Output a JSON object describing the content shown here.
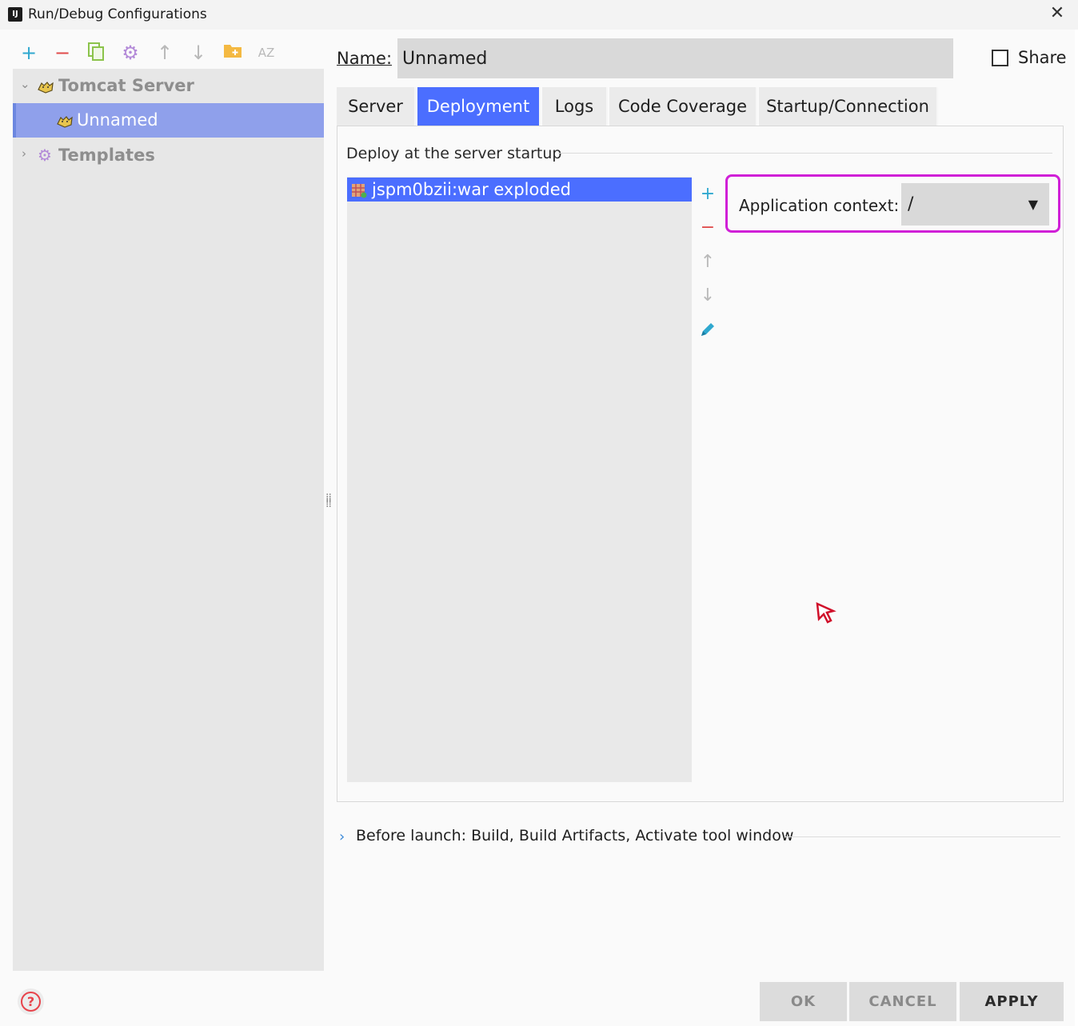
{
  "window": {
    "title": "Run/Debug Configurations"
  },
  "toolbar": {
    "add": "+",
    "remove": "−",
    "sort_label": "AZ"
  },
  "tree": {
    "group": "Tomcat Server",
    "child": "Unnamed",
    "templates": "Templates"
  },
  "form": {
    "name_label": "Name:",
    "name_value": "Unnamed",
    "share_label": "Share",
    "share_checked": false
  },
  "tabs": [
    {
      "label": "Server",
      "active": false
    },
    {
      "label": "Deployment",
      "active": true
    },
    {
      "label": "Logs",
      "active": false
    },
    {
      "label": "Code Coverage",
      "active": false
    },
    {
      "label": "Startup/Connection",
      "active": false
    }
  ],
  "deployment": {
    "section_title": "Deploy at the server startup",
    "artifacts": [
      "jspm0bzii:war exploded"
    ],
    "context_label": "Application context:",
    "context_value": "/"
  },
  "before_launch": {
    "label": "Before launch: Build, Build Artifacts, Activate tool window"
  },
  "buttons": {
    "ok": "OK",
    "cancel": "CANCEL",
    "apply": "APPLY"
  },
  "colors": {
    "accent": "#4b6eff",
    "highlight_box": "#d01fd7",
    "tree_selection": "#8fa0eb"
  }
}
